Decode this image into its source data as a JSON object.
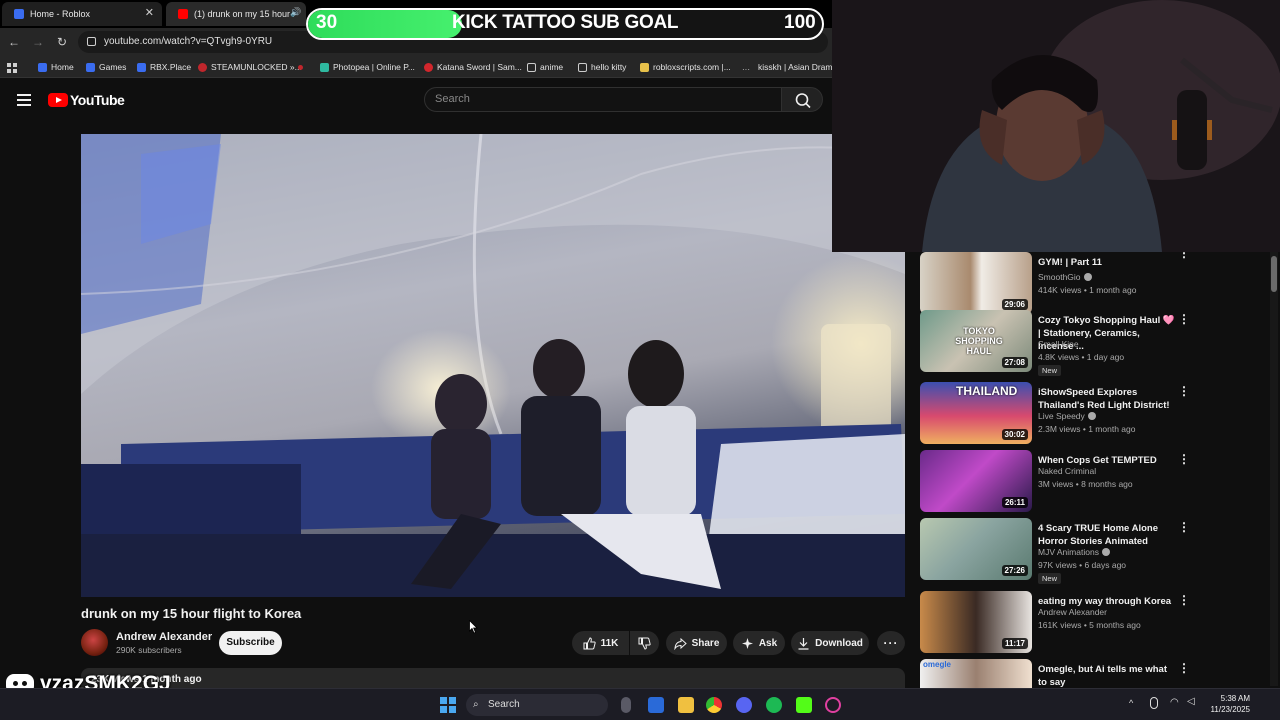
{
  "browser": {
    "tabs": [
      {
        "label": "Home - Roblox",
        "close": "✕"
      },
      {
        "label": "(1) drunk on my 15 hour fli",
        "close": "✕"
      }
    ],
    "url": "youtube.com/watch?v=QTvgh9-0YRU",
    "bookmarks": [
      {
        "label": "Home",
        "color": "#3a6cf0"
      },
      {
        "label": "Games",
        "color": "#3a6cf0"
      },
      {
        "label": "RBX.Place",
        "color": "#3a6cf0"
      },
      {
        "label": "STEAMUNLOCKED »...",
        "color": "#c0262c"
      },
      {
        "label": "",
        "color": "#c0262c"
      },
      {
        "label": "Photopea | Online P...",
        "color": "#2fb9a0"
      },
      {
        "label": "Katana Sword | Sam...",
        "color": "#d2262c"
      },
      {
        "label": "anime",
        "color": "#999999"
      },
      {
        "label": "hello kitty",
        "color": "#999999"
      },
      {
        "label": "robloxscripts.com |...",
        "color": "#e6c04a"
      },
      {
        "label": "kisskh | Asian Dram...",
        "color": "#888888"
      }
    ]
  },
  "youtube": {
    "logo_text": "YouTube",
    "search_placeholder": "Search",
    "video": {
      "title": "drunk on my 15 hour flight to Korea",
      "channel": "Andrew Alexander",
      "subscribers": "290K subscribers",
      "subscribe_label": "Subscribe",
      "likes": "11K",
      "share_label": "Share",
      "ask_label": "Ask",
      "download_label": "Download",
      "description_preview": "23K views  1 month ago"
    },
    "recommendations": [
      {
        "title": "GYM! | Part 11",
        "channel": "SmoothGio",
        "verified": true,
        "meta": "414K views • 1 month ago",
        "duration": "29:06",
        "new": false
      },
      {
        "title": "Cozy Tokyo Shopping Haul 🩷 | Stationery, Ceramics, Incense ...",
        "channel": "Small Kine",
        "verified": false,
        "meta": "4.8K views • 1 day ago",
        "duration": "27:08",
        "new": true,
        "thumb_text": "TOKYO SHOPPING HAUL"
      },
      {
        "title": "iShowSpeed Explores Thailand's Red Light District!",
        "channel": "Live Speedy",
        "verified": true,
        "meta": "2.3M views • 1 month ago",
        "duration": "30:02",
        "new": false,
        "thumb_text": "THAILAND"
      },
      {
        "title": "When Cops Get TEMPTED",
        "channel": "Naked Criminal",
        "verified": false,
        "meta": "3M views • 8 months ago",
        "duration": "26:11",
        "new": false
      },
      {
        "title": "4 Scary TRUE Home Alone Horror Stories Animated",
        "channel": "MJV Animations",
        "verified": true,
        "meta": "97K views • 6 days ago",
        "duration": "27:26",
        "new": true
      },
      {
        "title": "eating my way through Korea",
        "channel": "Andrew Alexander",
        "verified": false,
        "meta": "161K views • 5 months ago",
        "duration": "11:17",
        "new": false
      },
      {
        "title": "Omegle, but Ai tells me what to say",
        "channel": "",
        "verified": false,
        "meta": "",
        "duration": "",
        "new": false,
        "thumb_text": "omegle"
      }
    ],
    "new_badge": "New"
  },
  "stream_overlay": {
    "goal_title": "KICK TATTOO SUB GOAL",
    "goal_current": "30",
    "goal_target": "100",
    "goal_fraction": 0.3,
    "discord_name": "vzazSMK2GJ"
  },
  "taskbar": {
    "search_placeholder": "Search",
    "time": "5:38 AM",
    "date": "11/23/2025"
  }
}
